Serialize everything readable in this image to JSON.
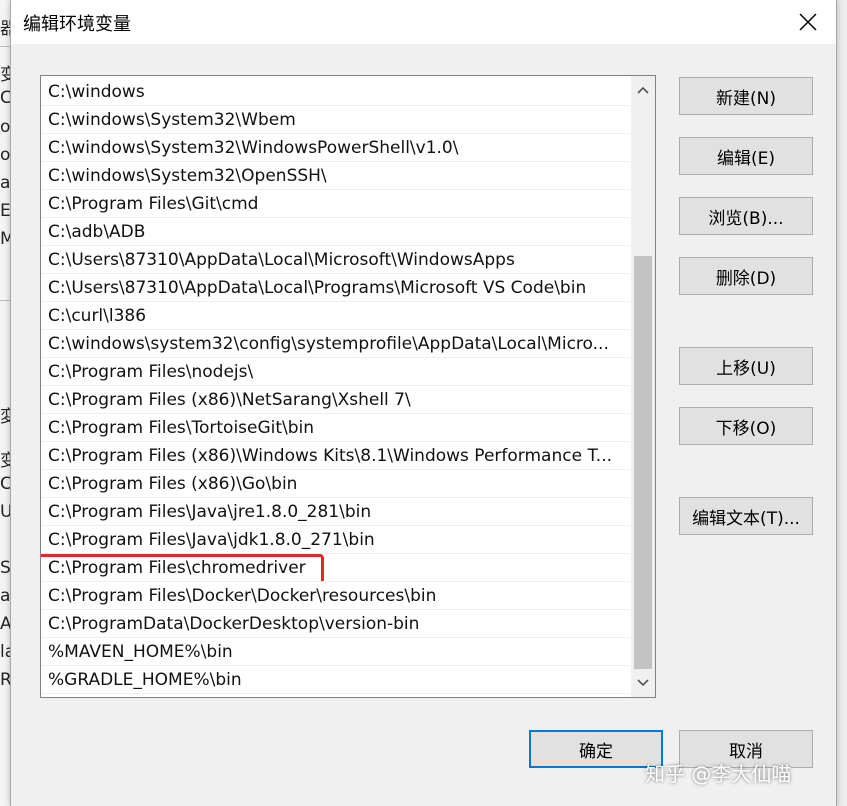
{
  "dialog": {
    "title": "编辑环境变量",
    "close_label": "×"
  },
  "path_list": {
    "items": [
      "C:\\windows",
      "C:\\windows\\System32\\Wbem",
      "C:\\windows\\System32\\WindowsPowerShell\\v1.0\\",
      "C:\\windows\\System32\\OpenSSH\\",
      "C:\\Program Files\\Git\\cmd",
      "C:\\adb\\ADB",
      "C:\\Users\\87310\\AppData\\Local\\Microsoft\\WindowsApps",
      "C:\\Users\\87310\\AppData\\Local\\Programs\\Microsoft VS Code\\bin",
      "C:\\curl\\l386",
      "C:\\windows\\system32\\config\\systemprofile\\AppData\\Local\\Micro...",
      "C:\\Program Files\\nodejs\\",
      "C:\\Program Files (x86)\\NetSarang\\Xshell 7\\",
      "C:\\Program Files\\TortoiseGit\\bin",
      "C:\\Program Files (x86)\\Windows Kits\\8.1\\Windows Performance T...",
      "C:\\Program Files (x86)\\Go\\bin",
      "C:\\Program Files\\Java\\jre1.8.0_281\\bin",
      "C:\\Program Files\\Java\\jdk1.8.0_271\\bin",
      "C:\\Program Files\\chromedriver",
      "C:\\Program Files\\Docker\\Docker\\resources\\bin",
      "C:\\ProgramData\\DockerDesktop\\version-bin",
      "%MAVEN_HOME%\\bin",
      "%GRADLE_HOME%\\bin"
    ],
    "highlighted_index": 17,
    "highlight_color": "#e02a2a"
  },
  "buttons": {
    "new": "新建(N)",
    "edit": "编辑(E)",
    "browse": "浏览(B)...",
    "delete": "删除(D)",
    "move_up": "上移(U)",
    "move_down": "下移(O)",
    "edit_text": "编辑文本(T)...",
    "ok": "确定",
    "cancel": "取消"
  },
  "background_window": {
    "clipped_chars": [
      "器",
      "变量",
      "C",
      "on",
      "on",
      "at",
      "E",
      "M",
      "変",
      "变量",
      "C",
      "U",
      "S",
      "at",
      "A",
      "la",
      "R"
    ]
  },
  "watermark": "知乎 @李大仙喵",
  "colors": {
    "accent": "#0078d7",
    "dialog_bg": "#f0f0f0",
    "button_bg": "#e1e1e1"
  }
}
